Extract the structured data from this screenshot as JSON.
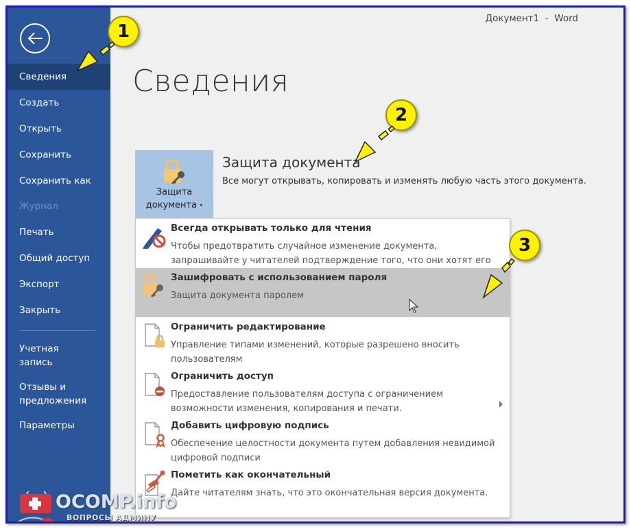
{
  "window": {
    "title": "Документ1  -  Word"
  },
  "sidebar": {
    "back_icon": "arrow-left-circle-icon",
    "items": [
      {
        "label": "Сведения",
        "state": "active"
      },
      {
        "label": "Создать",
        "state": "normal"
      },
      {
        "label": "Открыть",
        "state": "normal"
      },
      {
        "label": "Сохранить",
        "state": "normal"
      },
      {
        "label": "Сохранить как",
        "state": "normal"
      },
      {
        "label": "Журнал",
        "state": "disabled"
      },
      {
        "label": "Печать",
        "state": "normal"
      },
      {
        "label": "Общий доступ",
        "state": "normal"
      },
      {
        "label": "Экспорт",
        "state": "normal"
      },
      {
        "label": "Закрыть",
        "state": "normal"
      },
      {
        "label": "Учетная запись",
        "line1": "Учетная",
        "line2": "запись",
        "state": "normal"
      },
      {
        "label": "Отзывы и предложения",
        "line1": "Отзывы и",
        "line2": "предложения",
        "state": "normal"
      },
      {
        "label": "Параметры",
        "state": "normal"
      }
    ]
  },
  "main": {
    "page_title": "Сведения",
    "protect_button": {
      "line1": "Защита",
      "line2": "документа",
      "caret": "▾",
      "icon": "lock-key-icon"
    },
    "section_title": "Защита документа",
    "section_desc": "Все могут открывать, копировать и изменять любую часть этого документа."
  },
  "menu": {
    "items": [
      {
        "title": "Всегда открывать только для чтения",
        "desc": "Чтобы предотвратить случайное изменение документа, запрашивайте у читателей подтверждение того, что они хотят его править.",
        "icon": "pencil-prohibited-icon",
        "highlighted": false
      },
      {
        "title": "Зашифровать с использованием пароля",
        "desc": "Защита документа паролем",
        "icon": "lock-key-icon",
        "highlighted": true
      },
      {
        "title": "Ограничить редактирование",
        "desc": "Управление типами изменений, которые разрешено вносить пользователям",
        "icon": "document-lock-icon",
        "highlighted": false
      },
      {
        "title": "Ограничить доступ",
        "desc": "Предоставление пользователям доступа с ограничением возможности изменения, копирования и печати.",
        "icon": "document-restricted-icon",
        "highlighted": false,
        "has_submenu": true
      },
      {
        "title": "Добавить цифровую подпись",
        "desc": "Обеспечение целостности документа путем добавления невидимой цифровой подписи",
        "icon": "document-ribbon-icon",
        "highlighted": false
      },
      {
        "title": "Пометить как окончательный",
        "desc": "Дайте читателям знать, что это окончательная версия документа.",
        "icon": "document-stamp-icon",
        "highlighted": false
      }
    ]
  },
  "annotations": [
    {
      "number": "1"
    },
    {
      "number": "2"
    },
    {
      "number": "3"
    }
  ],
  "watermark": {
    "line1": "OCOMP.info",
    "line2": "ВОПРОСЫ АДМИНУ"
  },
  "colors": {
    "sidebar": "#2b579a",
    "sidebar_active": "#1e4274",
    "protect_button": "#a8c4e5",
    "menu_highlight": "#c6c6c6",
    "annotation": "#fff200",
    "frame_border": "#1b1fa8"
  }
}
